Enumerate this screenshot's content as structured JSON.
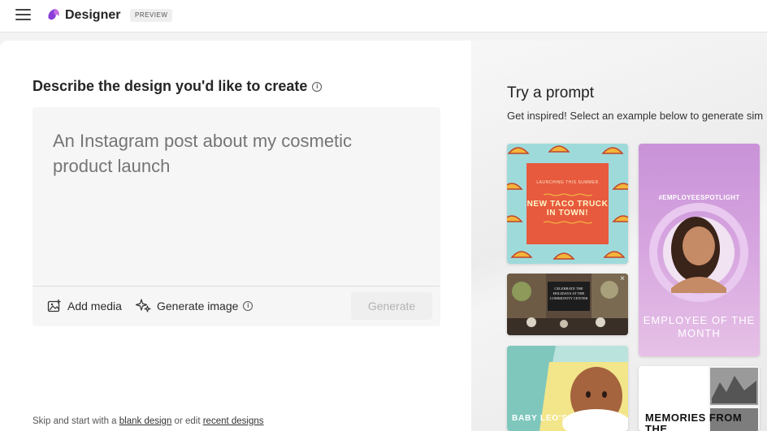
{
  "header": {
    "app_title": "Designer",
    "badge": "PREVIEW"
  },
  "create": {
    "title": "Describe the design you'd like to create",
    "prompt_placeholder": "An Instagram post about my cosmetic product launch",
    "add_media_label": "Add media",
    "generate_image_label": "Generate image",
    "generate_button": "Generate"
  },
  "skip": {
    "prefix": "Skip and start with a",
    "blank_link": "blank design",
    "middle": "or edit",
    "recent_link": "recent designs"
  },
  "prompts": {
    "title": "Try a prompt",
    "subtitle": "Get inspired! Select an example below to generate sim",
    "cards": {
      "taco_small": "LAUNCHING THIS SUMMER",
      "taco_big": "NEW TACO TRUCK IN TOWN!",
      "event_text": "CELEBRATE THE HOLIDAYS AT THE COMMUNITY CENTER",
      "employee_hashtag": "#EMPLOYEESPOTLIGHT",
      "employee_title": "EMPLOYEE OF THE MONTH",
      "baby_text": "BABY LEO'S BIRTHDAY",
      "memories_text": "MEMORIES FROM THE"
    }
  },
  "colors": {
    "taco_bg": "#9fdadb",
    "taco_panel": "#e75a3d",
    "employee_bg": "#c992d8",
    "logo_purple": "#8b3fd9"
  },
  "icons": [
    "menu-icon",
    "designer-logo-icon",
    "info-icon",
    "add-media-icon",
    "sparkle-icon"
  ]
}
